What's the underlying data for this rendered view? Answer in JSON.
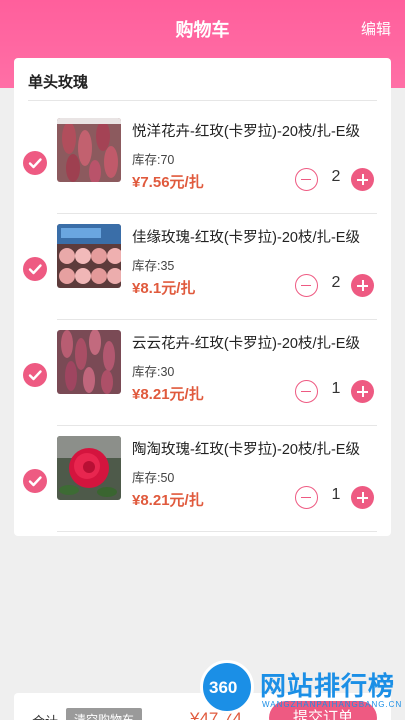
{
  "header": {
    "title": "购物车",
    "edit_label": "编辑"
  },
  "shop": {
    "name": "单头玫瑰"
  },
  "items": [
    {
      "name": "悦洋花卉-红玫(卡罗拉)-20枝/扎-E级",
      "stock": "库存:70",
      "price": "¥7.56元/扎",
      "qty": "2",
      "checked": true
    },
    {
      "name": "佳缘玫瑰-红玫(卡罗拉)-20枝/扎-E级",
      "stock": "库存:35",
      "price": "¥8.1元/扎",
      "qty": "2",
      "checked": true
    },
    {
      "name": "云云花卉-红玫(卡罗拉)-20枝/扎-E级",
      "stock": "库存:30",
      "price": "¥8.21元/扎",
      "qty": "1",
      "checked": true
    },
    {
      "name": "陶淘玫瑰-红玫(卡罗拉)-20枝/扎-E级",
      "stock": "库存:50",
      "price": "¥8.21元/扎",
      "qty": "1",
      "checked": true
    }
  ],
  "footer": {
    "total_label": "合计",
    "clear_label": "清空购物车",
    "total_value": "¥47.74",
    "submit_label": "提交订单"
  },
  "watermark": {
    "logo": "360",
    "text": "网站排行榜",
    "sub": "WANGZHANPAIHANGBANG.CN"
  },
  "colors": {
    "accent": "#ee5a82",
    "header": "#ff6fa6",
    "price": "#e05a3d"
  }
}
